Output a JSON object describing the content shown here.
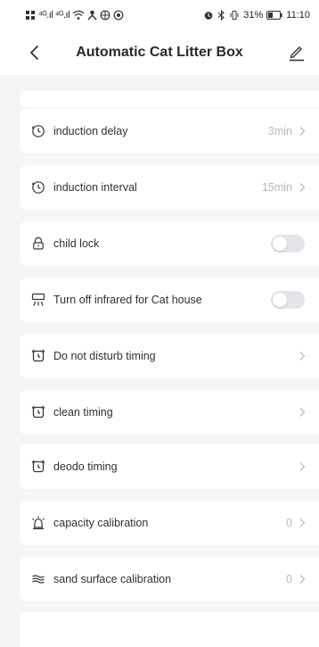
{
  "status_bar": {
    "signal_text": "⁴ᴳ.ıl ⁴ᴳ.ıl",
    "battery": "31%",
    "time": "11:10"
  },
  "header": {
    "title": "Automatic Cat Litter Box",
    "back_icon": "chevron-left-icon",
    "edit_icon": "pencil-icon"
  },
  "settings": [
    {
      "icon": "clock-icon",
      "label": "induction delay",
      "value": "3min",
      "control": "chevron"
    },
    {
      "icon": "clock-icon",
      "label": "induction interval",
      "value": "15min",
      "control": "chevron"
    },
    {
      "icon": "lock-icon",
      "label": "child lock",
      "value": "",
      "control": "toggle",
      "toggle_on": false
    },
    {
      "icon": "infrared-icon",
      "label": "Turn off infrared for Cat house",
      "value": "",
      "control": "toggle",
      "toggle_on": false
    },
    {
      "icon": "alarm-clock-icon",
      "label": "Do not disturb timing",
      "value": "",
      "control": "chevron"
    },
    {
      "icon": "alarm-clock-icon",
      "label": "clean timing",
      "value": "",
      "control": "chevron"
    },
    {
      "icon": "alarm-clock-icon",
      "label": "deodo timing",
      "value": "",
      "control": "chevron"
    },
    {
      "icon": "bell-icon",
      "label": "capacity calibration",
      "value": "0",
      "control": "chevron"
    },
    {
      "icon": "waves-icon",
      "label": "sand surface calibration",
      "value": "0",
      "control": "chevron"
    }
  ],
  "colors": {
    "background": "#f4f5f7",
    "card": "#ffffff",
    "toggle_off": "#e4e5e8",
    "value_text": "#b8b8b8"
  }
}
